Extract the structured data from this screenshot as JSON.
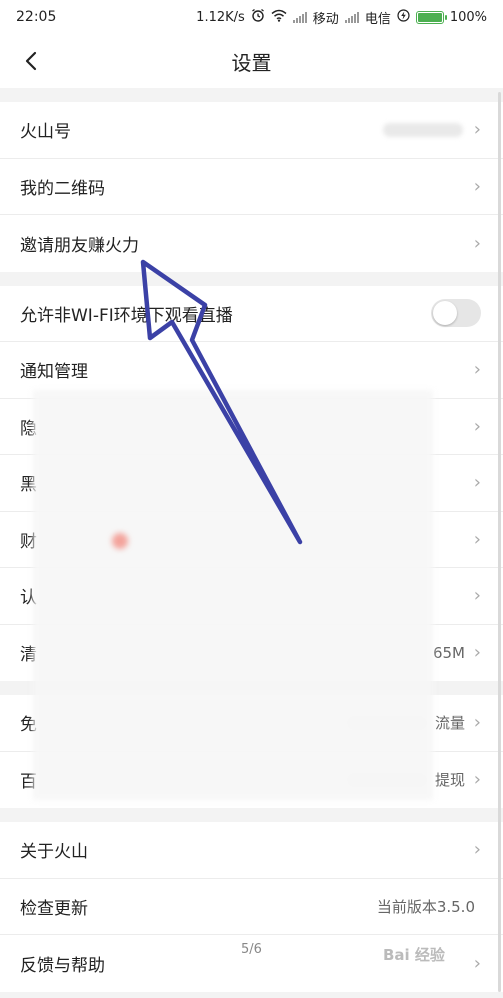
{
  "status": {
    "time": "22:05",
    "speed": "1.12K/s",
    "carrier1": "移动",
    "carrier2": "电信",
    "battery": "100%",
    "battery_level": 1.0
  },
  "nav": {
    "title": "设置"
  },
  "groups": [
    [
      {
        "label": "火山号",
        "value": ""
      },
      {
        "label": "我的二维码",
        "value": ""
      },
      {
        "label": "邀请朋友赚火力",
        "value": ""
      }
    ],
    [
      {
        "label": "允许非WI-FI环境下观看直播",
        "toggle": false
      },
      {
        "label": "通知管理",
        "value": ""
      },
      {
        "label": "隐",
        "value": ""
      },
      {
        "label": "黑",
        "value": ""
      },
      {
        "label": "财",
        "value": ""
      },
      {
        "label": "认",
        "value": ""
      },
      {
        "label": "清",
        "value": "65M"
      }
    ],
    [
      {
        "label": "免",
        "value": "流量"
      },
      {
        "label": "百",
        "value": "提现"
      }
    ],
    [
      {
        "label": "关于火山",
        "value": ""
      },
      {
        "label": "检查更新",
        "value": "当前版本3.5.0"
      },
      {
        "label": "反馈与帮助",
        "value": ""
      }
    ]
  ],
  "page_indicator": "5/6",
  "watermark": "Bai 经验",
  "colors": {
    "arrow": "#3b41a6",
    "toggle_off": "#e6e6e6",
    "battery": "#4caf50"
  },
  "icons": {
    "back": "back-chevron-icon",
    "row_arrow": "chevron-right-icon",
    "alarm": "alarm-icon",
    "wifi": "wifi-icon",
    "charging": "charging-icon"
  }
}
